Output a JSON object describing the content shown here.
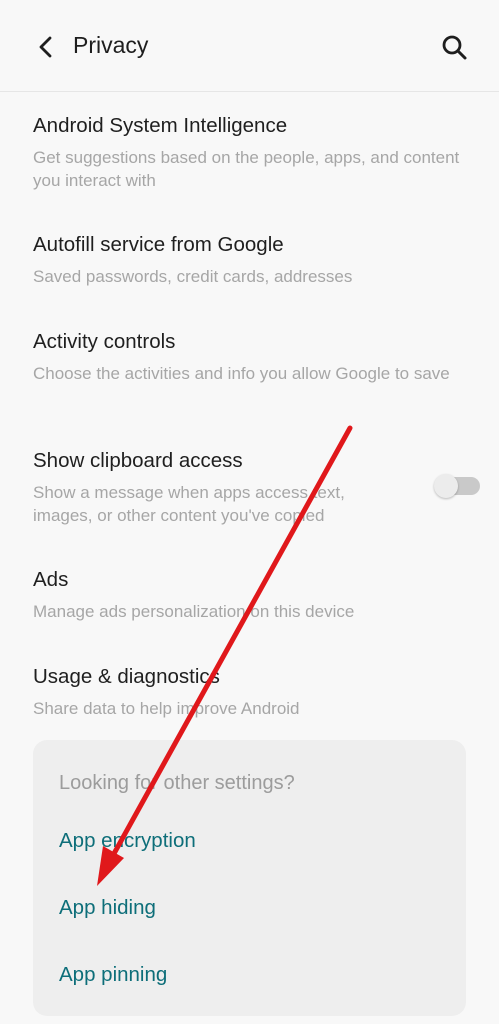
{
  "header": {
    "title": "Privacy"
  },
  "items": [
    {
      "title": "Android System Intelligence",
      "subtitle": "Get suggestions based on the people, apps, and content you interact with"
    },
    {
      "title": "Autofill service from Google",
      "subtitle": "Saved passwords, credit cards, addresses"
    },
    {
      "title": "Activity controls",
      "subtitle": "Choose the activities and info you allow Google to save"
    },
    {
      "title": "Show clipboard access",
      "subtitle": "Show a message when apps access text, images, or other content you've copied",
      "toggle_on": false
    },
    {
      "title": "Ads",
      "subtitle": "Manage ads personalization on this device"
    },
    {
      "title": "Usage & diagnostics",
      "subtitle": "Share data to help improve Android"
    }
  ],
  "other_settings": {
    "heading": "Looking for other settings?",
    "links": [
      "App encryption",
      "App hiding",
      "App pinning"
    ]
  },
  "colors": {
    "accent": "#0d6e79",
    "annotation_arrow": "#e0181b"
  }
}
